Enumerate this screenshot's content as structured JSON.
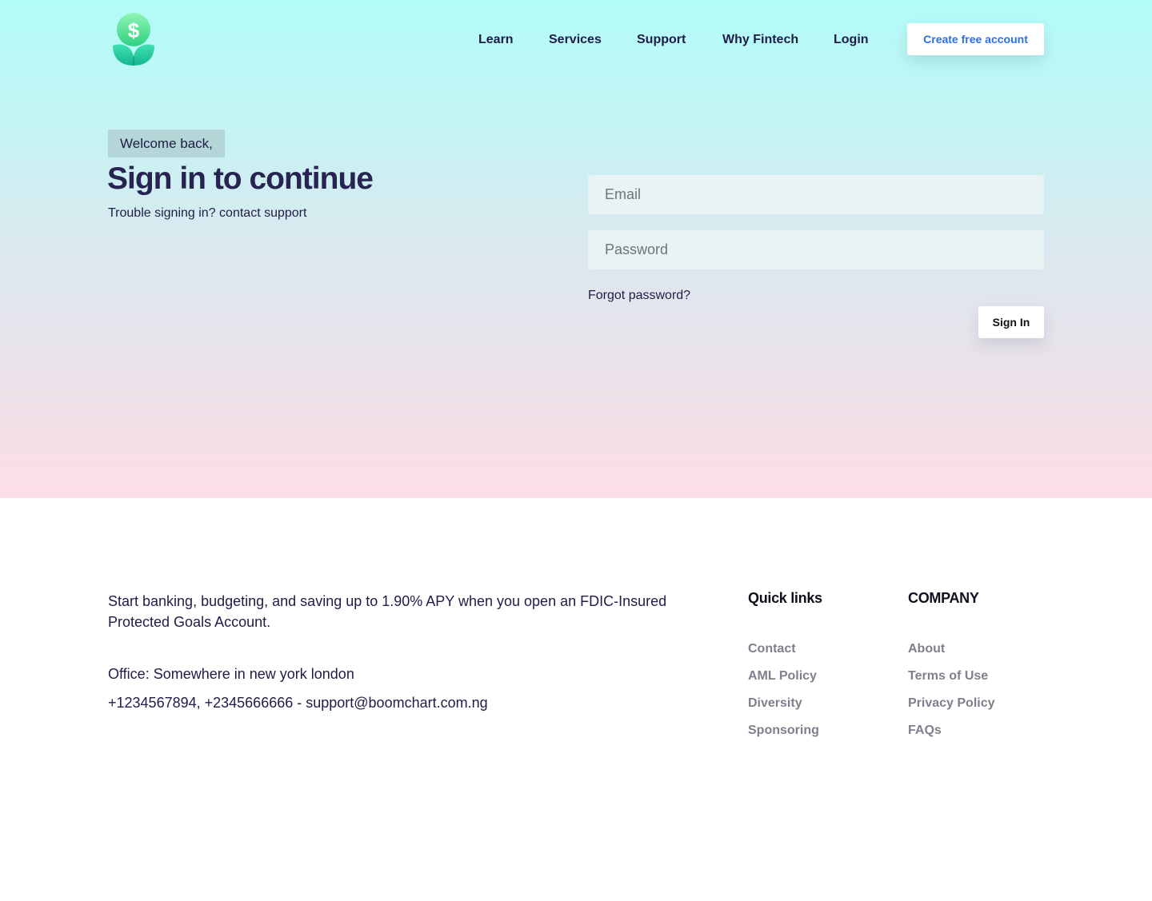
{
  "header": {
    "logo_icon": "dollar-sprout-icon",
    "nav": [
      "Learn",
      "Services",
      "Support",
      "Why Fintech",
      "Login"
    ],
    "cta_label": "Create free account"
  },
  "signin": {
    "badge": "Welcome back,",
    "title": "Sign in to continue",
    "subtitle": "Trouble signing in? contact support",
    "email_placeholder": "Email",
    "password_placeholder": "Password",
    "forgot_label": "Forgot password?",
    "button_label": "Sign In"
  },
  "footer": {
    "blurb": "Start banking, budgeting, and saving up to 1.90% APY when you open an FDIC-Insured Protected Goals Account.",
    "office": "Office: Somewhere in new york london",
    "contact": "+1234567894, +2345666666 - support@boomchart.com.ng",
    "quick_links_title": "Quick links",
    "quick_links": [
      "Contact",
      "AML Policy",
      "Diversity",
      "Sponsoring"
    ],
    "company_title": "COMPANY",
    "company_links": [
      "About",
      "Terms of Use",
      "Privacy Policy",
      "FAQs"
    ]
  },
  "colors": {
    "brand_dark": "#1f1d47",
    "cta_text": "#2b6fe6",
    "footer_link": "#7f7f8c",
    "hero_top": "#b2fcf9",
    "hero_bottom": "#fddde7"
  }
}
